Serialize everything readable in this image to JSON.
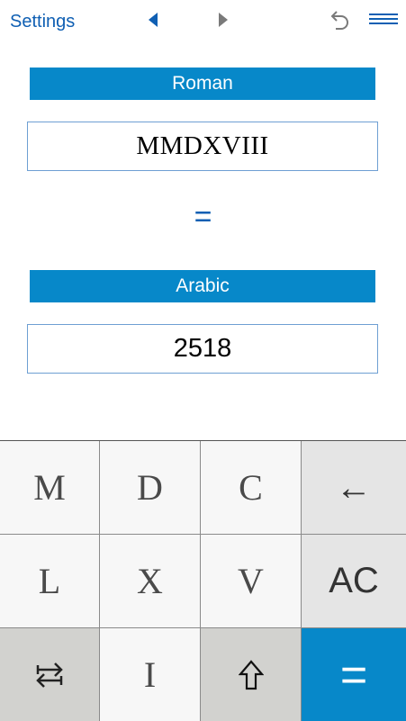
{
  "topbar": {
    "settings_label": "Settings",
    "icons": [
      "prev-arrow-icon",
      "next-arrow-icon",
      "undo-icon",
      "menu-icon"
    ],
    "colors": {
      "link": "#0f5fb3",
      "arrow_active": "#0f5fb3",
      "arrow_inactive": "#7a7a7a"
    }
  },
  "converter": {
    "roman_label": "Roman",
    "roman_value": "MMDXVIII",
    "equals": "=",
    "arabic_label": "Arabic",
    "arabic_value": "2518",
    "header_color": "#0788c9"
  },
  "keypad": {
    "keys": [
      {
        "label": "M"
      },
      {
        "label": "D"
      },
      {
        "label": "C"
      },
      {
        "label": "←"
      },
      {
        "label": "L"
      },
      {
        "label": "X"
      },
      {
        "label": "V"
      },
      {
        "label": "AC"
      },
      {
        "label": "⇆",
        "icon": "swap-icon"
      },
      {
        "label": "I"
      },
      {
        "label": "⇧",
        "icon": "shift-icon"
      },
      {
        "label": "="
      }
    ]
  }
}
